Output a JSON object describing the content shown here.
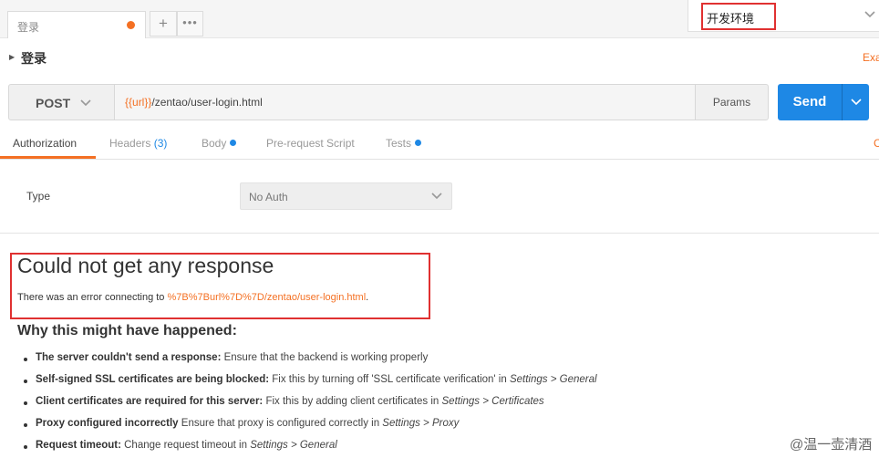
{
  "tabs": {
    "active_tab_label": "登录",
    "new_tab": "+",
    "more": "•••"
  },
  "environment": {
    "selected": "开发环境"
  },
  "request": {
    "name": "登录",
    "examples_link": "Exa",
    "method": "POST",
    "url_variable": "{{url}}",
    "url_path": "/zentao/user-login.html",
    "params_label": "Params",
    "send_label": "Send"
  },
  "subtabs": {
    "authorization": "Authorization",
    "headers": "Headers",
    "headers_count": "(3)",
    "body": "Body",
    "prerequest": "Pre-request Script",
    "tests": "Tests",
    "edge_text": "C"
  },
  "auth": {
    "type_label": "Type",
    "type_value": "No Auth"
  },
  "response": {
    "error_title": "Could not get any response",
    "error_prefix": "There was an error connecting to ",
    "error_url": "%7B%7Burl%7D%7D/zentao/user-login.html",
    "error_suffix": ".",
    "why_title": "Why this might have happened:",
    "reasons": [
      {
        "bold": "The server couldn't send a response:",
        "text": " Ensure that the backend is working properly",
        "em": "",
        "tail": ""
      },
      {
        "bold": "Self-signed SSL certificates are being blocked:",
        "text": " Fix this by turning off 'SSL certificate verification' in ",
        "em": "Settings > General",
        "tail": ""
      },
      {
        "bold": "Client certificates are required for this server:",
        "text": " Fix this by adding client certificates in ",
        "em": "Settings > Certificates",
        "tail": ""
      },
      {
        "bold": "Proxy configured incorrectly",
        "text": " Ensure that proxy is configured correctly in ",
        "em": "Settings > Proxy",
        "tail": ""
      },
      {
        "bold": "Request timeout:",
        "text": " Change request timeout in ",
        "em": "Settings > General",
        "tail": ""
      }
    ]
  },
  "watermark": "@温一壶清酒",
  "colors": {
    "accent_orange": "#f47023",
    "send_blue": "#1e88e5",
    "highlight_red": "#e03131"
  },
  "icons": [
    "chevron-down-icon",
    "caret-right-icon",
    "unsaved-dot-icon"
  ]
}
